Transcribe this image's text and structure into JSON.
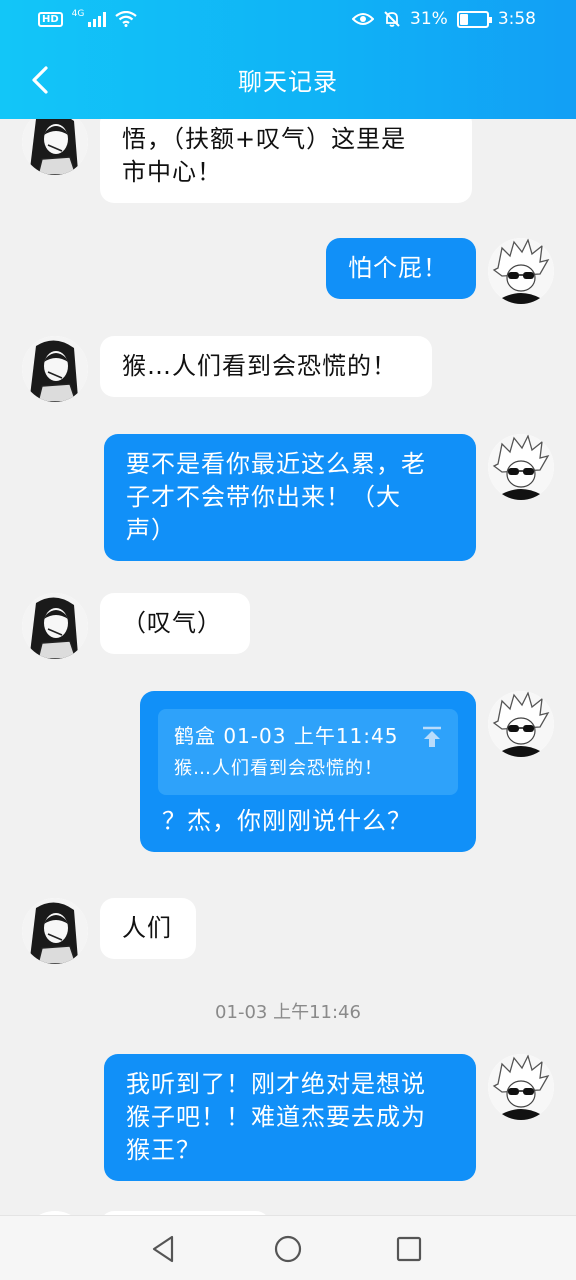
{
  "status_bar": {
    "hd": "HD",
    "network": "4G",
    "battery_pct": "31%",
    "battery_level": 0.31,
    "time": "3:58"
  },
  "header": {
    "title": "聊天记录"
  },
  "messages": [
    {
      "side": "left",
      "lines": [
        "悟，（扶额+叹气）这里是",
        "市中心！"
      ]
    },
    {
      "side": "right",
      "lines": [
        "怕个屁！"
      ]
    },
    {
      "side": "left",
      "lines": [
        "猴…人们看到会恐慌的！"
      ]
    },
    {
      "side": "right",
      "lines": [
        "要不是看你最近这么累，老",
        "子才不会带你出来！（大",
        "声）"
      ]
    },
    {
      "side": "left",
      "lines": [
        "（叹气）"
      ]
    },
    {
      "side": "right",
      "quote": {
        "meta": "鹤盒 01-03 上午11:45",
        "text": "猴…人们看到会恐慌的！"
      },
      "lines": [
        "？杰，你刚刚说什么？"
      ]
    },
    {
      "side": "left",
      "lines": [
        "人们"
      ]
    },
    {
      "side": "right",
      "lines": [
        "我听到了！刚才绝对是想说",
        "猴子吧！！难道杰要去成为",
        "猴王？"
      ]
    }
  ],
  "timestamp": "01-03 上午11:46",
  "colors": {
    "header_start": "#12c6f8",
    "header_end": "#129ff5",
    "bubble_right": "#1190f8",
    "bubble_left": "#ffffff",
    "background": "#f1f1f1"
  },
  "icons": {
    "back": "chevron-left-icon",
    "eye": "eye-icon",
    "mute": "bell-off-icon",
    "quote": "arrow-up-to-line-icon",
    "nav_back": "triangle-back-icon",
    "nav_home": "circle-home-icon",
    "nav_recent": "square-recent-icon"
  }
}
